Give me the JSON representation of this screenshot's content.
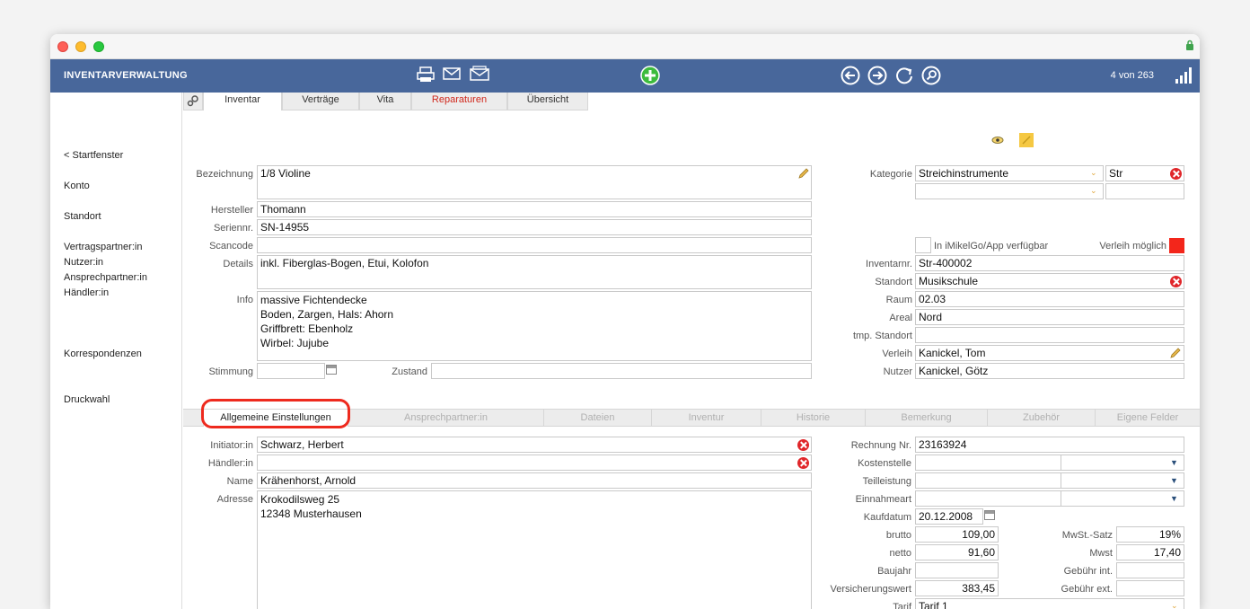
{
  "header": {
    "app_title": "INVENTARVERWALTUNG",
    "counter": "4 von 263",
    "icons": [
      "printer-icon",
      "mail-icon",
      "mail-open-icon",
      "add-icon",
      "back-icon",
      "forward-icon",
      "refresh-icon",
      "search-icon",
      "signal-icon"
    ]
  },
  "sidebar": {
    "items": [
      "< Startfenster",
      "Konto",
      "Standort",
      "Vertragspartner:in",
      "Nutzer:in",
      "Ansprechpartner:in",
      "Händler:in",
      "Korrespondenzen",
      "Druckwahl"
    ]
  },
  "tabs": [
    {
      "label": "Inventar",
      "active": true
    },
    {
      "label": "Verträge",
      "active": false
    },
    {
      "label": "Vita",
      "active": false
    },
    {
      "label": "Reparaturen",
      "active": false
    },
    {
      "label": "Übersicht",
      "active": false
    }
  ],
  "left_fields": {
    "bezeichnung_label": "Bezeichnung",
    "bezeichnung": "1/8 Violine",
    "hersteller_label": "Hersteller",
    "hersteller": "Thomann",
    "seriennr_label": "Seriennr.",
    "seriennr": "SN-14955",
    "scancode_label": "Scancode",
    "scancode": "",
    "details_label": "Details",
    "details": "inkl. Fiberglas-Bogen, Etui, Kolofon",
    "info_label": "Info",
    "info": "massive Fichtendecke\nBoden, Zargen, Hals: Ahorn\nGriffbrett: Ebenholz\nWirbel: Jujube",
    "stimmung_label": "Stimmung",
    "stimmung": "",
    "zustand_label": "Zustand",
    "zustand": ""
  },
  "right_fields": {
    "kategorie_label": "Kategorie",
    "kategorie": "Streichinstrumente",
    "kategorie_code": "Str",
    "imikelgo_label": "In iMikelGo/App verfügbar",
    "verleih_moeglich_label": "Verleih möglich",
    "inventarnr_label": "Inventarnr.",
    "inventarnr": "Str-400002",
    "standort_label": "Standort",
    "standort": "Musikschule",
    "raum_label": "Raum",
    "raum": "02.03",
    "areal_label": "Areal",
    "areal": "Nord",
    "tmp_standort_label": "tmp. Standort",
    "tmp_standort": "",
    "verleih_label": "Verleih",
    "verleih": "Kanickel, Tom",
    "nutzer_label": "Nutzer",
    "nutzer": "Kanickel, Götz"
  },
  "subtabs": [
    {
      "label": "Allgemeine Einstellungen",
      "active": true
    },
    {
      "label": "Ansprechpartner:in",
      "active": false
    },
    {
      "label": "Dateien",
      "active": false
    },
    {
      "label": "Inventur",
      "active": false
    },
    {
      "label": "Historie",
      "active": false
    },
    {
      "label": "Bemerkung",
      "active": false
    },
    {
      "label": "Zubehör",
      "active": false
    },
    {
      "label": "Eigene Felder",
      "active": false
    }
  ],
  "general": {
    "initiator_label": "Initiator:in",
    "initiator": "Schwarz, Herbert",
    "haendler_label": "Händler:in",
    "haendler": "",
    "name_label": "Name",
    "name": "Krähenhorst, Arnold",
    "adresse_label": "Adresse",
    "adresse": "Krokodilsweg 25\n12348 Musterhausen"
  },
  "finance": {
    "rechnung_label": "Rechnung Nr.",
    "rechnung": "23163924",
    "kostenstelle_label": "Kostenstelle",
    "teilleistung_label": "Teilleistung",
    "einnahmeart_label": "Einnahmeart",
    "kaufdatum_label": "Kaufdatum",
    "kaufdatum": "20.12.2008",
    "brutto_label": "brutto",
    "brutto": "109,00",
    "netto_label": "netto",
    "netto": "91,60",
    "baujahr_label": "Baujahr",
    "baujahr": "",
    "versicherungswert_label": "Versicherungswert",
    "versicherungswert": "383,45",
    "tarif_label": "Tarif",
    "tarif": "Tarif 1",
    "mwst_satz_label": "MwSt.-Satz",
    "mwst_satz": "19%",
    "mwst_label": "Mwst",
    "mwst": "17,40",
    "gebuehr_int_label": "Gebühr int.",
    "gebuehr_int": "",
    "gebuehr_ext_label": "Gebühr ext.",
    "gebuehr_ext": ""
  }
}
